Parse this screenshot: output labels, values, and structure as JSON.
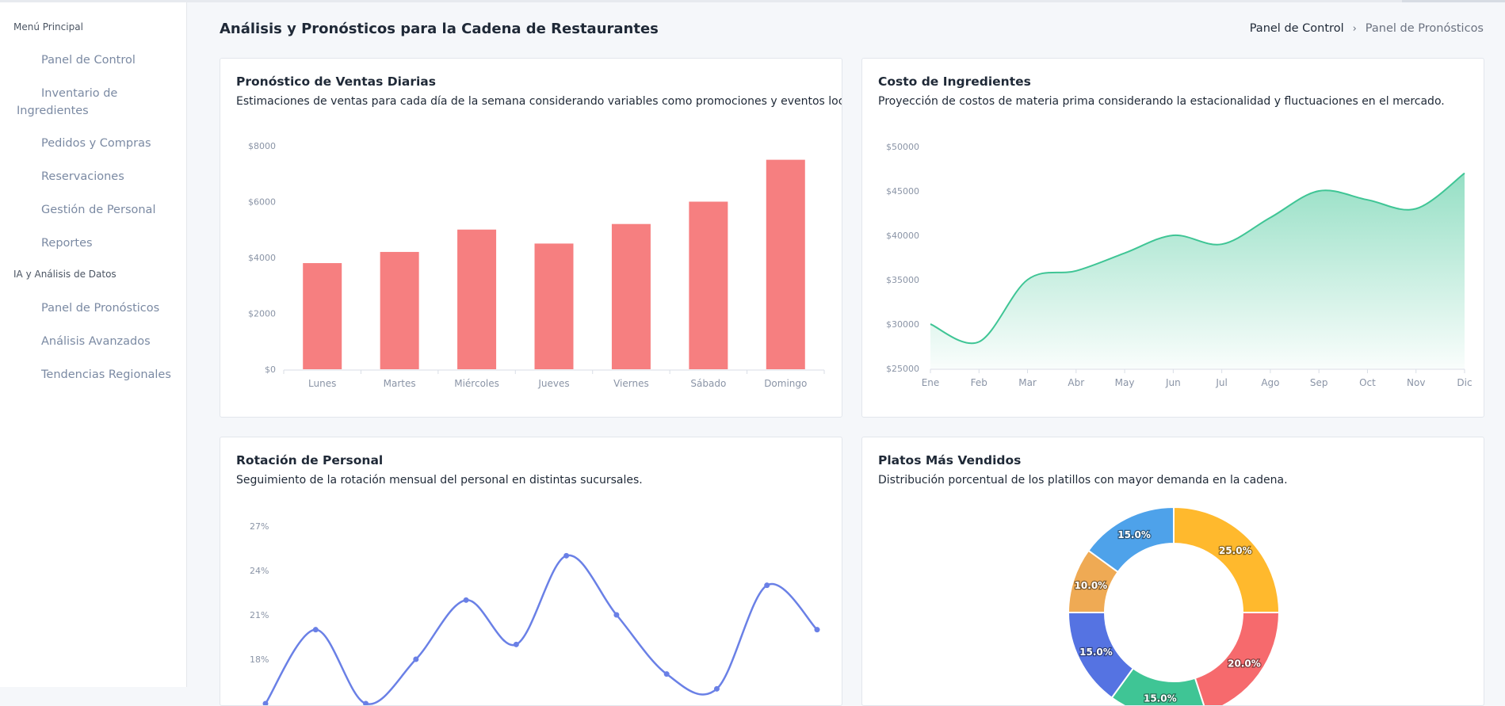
{
  "sidebar": {
    "sections": [
      {
        "title": "Menú Principal",
        "items": [
          "Panel de Control",
          "Inventario de Ingredientes",
          "Pedidos y Compras",
          "Reservaciones",
          "Gestión de Personal",
          "Reportes"
        ]
      },
      {
        "title": "IA y Análisis de Datos",
        "items": [
          "Panel de Pronósticos",
          "Análisis Avanzados",
          "Tendencias Regionales"
        ]
      }
    ]
  },
  "header": {
    "title": "Análisis y Pronósticos para la Cadena de Restaurantes",
    "breadcrumb": {
      "root": "Panel de Control",
      "separator": "›",
      "current": "Panel de Pronósticos"
    }
  },
  "cards": [
    {
      "title": "Pronóstico de Ventas Diarias",
      "description": "Estimaciones de ventas para cada día de la semana considerando variables como promociones y eventos locales."
    },
    {
      "title": "Costo de Ingredientes",
      "description": "Proyección de costos de materia prima considerando la estacionalidad y fluctuaciones en el mercado."
    },
    {
      "title": "Rotación de Personal",
      "description": "Seguimiento de la rotación mensual del personal en distintas sucursales."
    },
    {
      "title": "Platos Más Vendidos",
      "description": "Distribución porcentual de los platillos con mayor demanda en la cadena."
    }
  ],
  "chart_data": [
    {
      "type": "bar",
      "categories": [
        "Lunes",
        "Martes",
        "Miércoles",
        "Jueves",
        "Viernes",
        "Sábado",
        "Domingo"
      ],
      "values": [
        3800,
        4200,
        5000,
        4500,
        5200,
        6000,
        7500
      ],
      "ylim": [
        0,
        8000
      ],
      "yticks": [
        "$0",
        "$2000",
        "$4000",
        "$6000",
        "$8000"
      ],
      "grid": false,
      "color": "#f67f80"
    },
    {
      "type": "area",
      "categories": [
        "Ene",
        "Feb",
        "Mar",
        "Abr",
        "May",
        "Jun",
        "Jul",
        "Ago",
        "Sep",
        "Oct",
        "Nov",
        "Dic"
      ],
      "values": [
        30000,
        28000,
        35000,
        36000,
        38000,
        40000,
        39000,
        42000,
        45000,
        44000,
        43000,
        47000
      ],
      "ylim": [
        25000,
        50000
      ],
      "yticks": [
        "$25000",
        "$30000",
        "$35000",
        "$40000",
        "$45000",
        "$50000"
      ],
      "grid": false,
      "color": "#3fc595"
    },
    {
      "type": "line",
      "values": [
        15,
        20,
        15,
        18,
        22,
        19,
        25,
        21,
        17,
        16,
        23,
        20
      ],
      "ylim": [
        15,
        27
      ],
      "yticks": [
        "18%",
        "21%",
        "24%",
        "27%"
      ],
      "grid": false,
      "color": "#6a80e6"
    },
    {
      "type": "pie",
      "labels": [
        "25.0%",
        "20.0%",
        "15.0%",
        "15.0%",
        "10.0%",
        "15.0%"
      ],
      "values": [
        25,
        20,
        15,
        15,
        10,
        15
      ],
      "colors": [
        "#ffb92d",
        "#f66a6d",
        "#3fc595",
        "#5573e2",
        "#efaa54",
        "#4ea2ea"
      ],
      "donut": true
    }
  ]
}
